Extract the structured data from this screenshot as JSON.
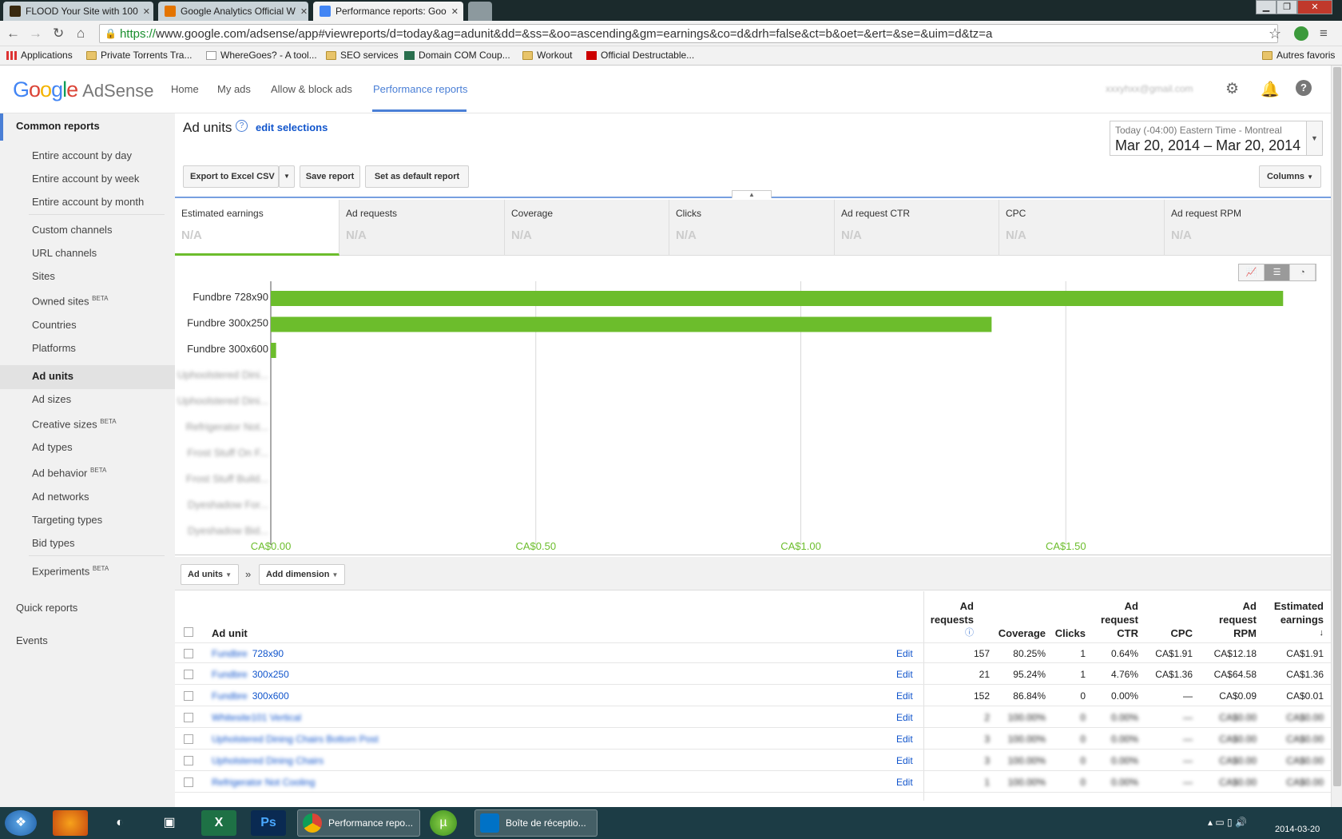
{
  "browser": {
    "tabs": [
      {
        "label": "FLOOD Your Site with 100",
        "active": false,
        "color": "#3a2a10"
      },
      {
        "label": "Google Analytics Official W",
        "active": false,
        "color": "#e37400"
      },
      {
        "label": "Performance reports: Goo",
        "active": true,
        "color": "#4285f4"
      }
    ],
    "tab_close": "✕",
    "window_controls": [
      "▁",
      "❐",
      "✕"
    ],
    "url_https": "https://",
    "url_rest": "www.google.com/adsense/app#viewreports/d=today&ag=adunit&dd=&ss=&oo=ascending&gm=earnings&co=d&drh=false&ct=b&oet=&ert=&se=&uim=d&tz=a",
    "bookmarks": [
      {
        "label": "Applications",
        "icon": "apps-icon"
      },
      {
        "label": "Private Torrents Tra...",
        "icon": "folder-icon"
      },
      {
        "label": "WhereGoes? - A tool...",
        "icon": "page-icon"
      },
      {
        "label": "SEO services",
        "icon": "folder-icon"
      },
      {
        "label": "Domain COM Coup...",
        "icon": "m-icon"
      },
      {
        "label": "Workout",
        "icon": "folder-icon"
      },
      {
        "label": "Official Destructable...",
        "icon": "pdf-icon"
      }
    ],
    "other_bookmarks": "Autres favoris"
  },
  "app": {
    "logo_google": "Google",
    "logo_product": "AdSense",
    "nav": [
      "Home",
      "My ads",
      "Allow & block ads",
      "Performance reports"
    ],
    "account": "xxxyhxx@gmail.com"
  },
  "sidebar": {
    "common": "Common reports",
    "items": [
      {
        "label": "Entire account by day",
        "beta": ""
      },
      {
        "label": "Entire account by week",
        "beta": ""
      },
      {
        "label": "Entire account by month",
        "beta": ""
      },
      {
        "label": "Custom channels",
        "beta": ""
      },
      {
        "label": "URL channels",
        "beta": ""
      },
      {
        "label": "Sites",
        "beta": ""
      },
      {
        "label": "Owned sites",
        "beta": "BETA"
      },
      {
        "label": "Countries",
        "beta": ""
      },
      {
        "label": "Platforms",
        "beta": ""
      },
      {
        "label": "Ad units",
        "beta": ""
      },
      {
        "label": "Ad sizes",
        "beta": ""
      },
      {
        "label": "Creative sizes",
        "beta": "BETA"
      },
      {
        "label": "Ad types",
        "beta": ""
      },
      {
        "label": "Ad behavior",
        "beta": "BETA"
      },
      {
        "label": "Ad networks",
        "beta": ""
      },
      {
        "label": "Targeting types",
        "beta": ""
      },
      {
        "label": "Bid types",
        "beta": ""
      },
      {
        "label": "Experiments",
        "beta": "BETA"
      }
    ],
    "quick": "Quick reports",
    "events": "Events"
  },
  "report": {
    "title": "Ad units",
    "help": "?",
    "edit_selections": "edit selections",
    "timezone": "Today (-04:00) Eastern Time - Montreal",
    "dates": "Mar 20, 2014 – Mar 20, 2014",
    "export": "Export to Excel CSV",
    "save": "Save report",
    "default": "Set as default report",
    "columns": "Columns"
  },
  "metrics": [
    {
      "label": "Estimated earnings",
      "value": "N/A"
    },
    {
      "label": "Ad requests",
      "value": "N/A"
    },
    {
      "label": "Coverage",
      "value": "N/A"
    },
    {
      "label": "Clicks",
      "value": "N/A"
    },
    {
      "label": "Ad request CTR",
      "value": "N/A"
    },
    {
      "label": "CPC",
      "value": "N/A"
    },
    {
      "label": "Ad request RPM",
      "value": "N/A"
    }
  ],
  "chart_data": {
    "type": "bar",
    "categories": [
      "Fundbre 728x90",
      "Fundbre 300x250",
      "Fundbre 300x600",
      "Uphoolstered Dini...",
      "Uphoolstered Dini...",
      "Refrigerator Not...",
      "Frost Stuff On F...",
      "Frost Stuff Build...",
      "Dyeshadow For...",
      "Dyeshadow Bid..."
    ],
    "values": [
      1.91,
      1.36,
      0.01,
      0,
      0,
      0,
      0,
      0,
      0,
      0
    ],
    "blurred_from": 3,
    "xlim": [
      0,
      2.0
    ],
    "xticks": [
      0,
      0.5,
      1.0,
      1.5
    ],
    "xtick_labels": [
      "CA$0.00",
      "CA$0.50",
      "CA$1.00",
      "CA$1.50"
    ],
    "bar_color": "#6cbd2c",
    "grid": true
  },
  "dimension": {
    "first": "Ad units",
    "sep": "»",
    "add": "Add dimension"
  },
  "table": {
    "headers": {
      "ad_unit": "Ad unit",
      "requests": [
        "Ad",
        "requests"
      ],
      "coverage": "Coverage",
      "clicks": "Clicks",
      "ctr": [
        "Ad",
        "request",
        "CTR"
      ],
      "cpc": "CPC",
      "rpm": [
        "Ad",
        "request",
        "RPM"
      ],
      "earnings": [
        "Estimated",
        "earnings"
      ]
    },
    "edit": "Edit",
    "rows": [
      {
        "prefix": "Fundbre",
        "name": "728x90",
        "requests": "157",
        "coverage": "80.25%",
        "clicks": "1",
        "ctr": "0.64%",
        "cpc": "CA$1.91",
        "rpm": "CA$12.18",
        "earnings": "CA$1.91",
        "blur": false
      },
      {
        "prefix": "Fundbre",
        "name": "300x250",
        "requests": "21",
        "coverage": "95.24%",
        "clicks": "1",
        "ctr": "4.76%",
        "cpc": "CA$1.36",
        "rpm": "CA$64.58",
        "earnings": "CA$1.36",
        "blur": false
      },
      {
        "prefix": "Fundbre",
        "name": "300x600",
        "requests": "152",
        "coverage": "86.84%",
        "clicks": "0",
        "ctr": "0.00%",
        "cpc": "—",
        "rpm": "CA$0.09",
        "earnings": "CA$0.01",
        "blur": false
      },
      {
        "prefix": "",
        "name": "Whitesite101 Vertical",
        "requests": "2",
        "coverage": "100.00%",
        "clicks": "0",
        "ctr": "0.00%",
        "cpc": "—",
        "rpm": "CA$0.00",
        "earnings": "CA$0.00",
        "blur": true
      },
      {
        "prefix": "",
        "name": "Upholstered Dining Chairs Bottom Post",
        "requests": "3",
        "coverage": "100.00%",
        "clicks": "0",
        "ctr": "0.00%",
        "cpc": "—",
        "rpm": "CA$0.00",
        "earnings": "CA$0.00",
        "blur": true
      },
      {
        "prefix": "",
        "name": "Upholstered Dining Chairs",
        "requests": "3",
        "coverage": "100.00%",
        "clicks": "0",
        "ctr": "0.00%",
        "cpc": "—",
        "rpm": "CA$0.00",
        "earnings": "CA$0.00",
        "blur": true
      },
      {
        "prefix": "",
        "name": "Refrigerator Not Cooling",
        "requests": "1",
        "coverage": "100.00%",
        "clicks": "0",
        "ctr": "0.00%",
        "cpc": "—",
        "rpm": "CA$0.00",
        "earnings": "CA$0.00",
        "blur": true
      }
    ]
  },
  "taskbar": {
    "windows": [
      {
        "label": "Performance repo...",
        "color": "#db4437"
      },
      {
        "label": "Boîte de réceptio...",
        "color": "#0072c6"
      }
    ],
    "clock": "2014-03-20"
  }
}
